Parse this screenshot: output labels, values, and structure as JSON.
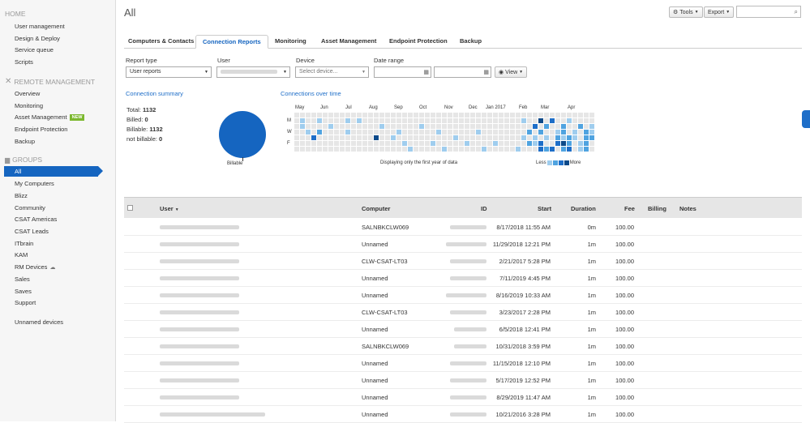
{
  "sidebar": {
    "home_header": "HOME",
    "home_items": [
      "User management",
      "Design & Deploy",
      "Service queue",
      "Scripts"
    ],
    "remote_header": "REMOTE MANAGEMENT",
    "remote_items": [
      "Overview",
      "Monitoring",
      "Asset Management",
      "Endpoint Protection",
      "Backup"
    ],
    "new_badge": "NEW",
    "groups_header": "GROUPS",
    "selected_group": "All",
    "group_items": [
      "My Computers",
      "Blizz",
      "Community",
      "CSAT Americas",
      "CSAT Leads",
      "ITbrain",
      "KAM",
      "RM Devices",
      "Sales",
      "Saves",
      "Support"
    ],
    "unnamed": "Unnamed devices"
  },
  "header": {
    "title": "All",
    "tools": "Tools",
    "export": "Export",
    "search_placeholder": ""
  },
  "tabs": [
    "Computers & Contacts",
    "Connection Reports",
    "Monitoring",
    "Asset Management",
    "Endpoint Protection",
    "Backup"
  ],
  "filters": {
    "report_type_label": "Report type",
    "report_type_value": "User reports",
    "user_label": "User",
    "device_label": "Device",
    "device_placeholder": "Select device...",
    "date_range_label": "Date range",
    "view_button": "View"
  },
  "summary": {
    "title": "Connection summary",
    "total_label": "Total:",
    "total": "1132",
    "billed_label": "Billed:",
    "billed": "0",
    "billable_label": "Billable:",
    "billable": "1132",
    "not_billable_label": "not billable:",
    "not_billable": "0",
    "pie_label": "Billable"
  },
  "heatmap": {
    "title": "Connections over time",
    "months": [
      "May",
      "Jun",
      "Jul",
      "Aug",
      "Sep",
      "Oct",
      "Nov",
      "Dec",
      "Jan 2017",
      "Feb",
      "Mar",
      "Apr"
    ],
    "days": [
      "M",
      "W",
      "F"
    ],
    "note": "Displaying only the first year of data",
    "less": "Less",
    "more": "More",
    "colors": [
      "#e6e6e6",
      "#9fcdee",
      "#4fa3e0",
      "#1e6ec8",
      "#0d4a8a"
    ]
  },
  "table": {
    "headers": {
      "user": "User",
      "computer": "Computer",
      "id": "ID",
      "start": "Start",
      "duration": "Duration",
      "fee": "Fee",
      "billing": "Billing",
      "notes": "Notes"
    },
    "rows": [
      {
        "computer": "SALNBKCLW069",
        "start": "8/17/2018 11:55 AM",
        "duration": "0m",
        "fee": "100.00"
      },
      {
        "computer": "Unnamed",
        "start": "11/29/2018 12:21 PM",
        "duration": "1m",
        "fee": "100.00"
      },
      {
        "computer": "CLW-CSAT-LT03",
        "start": "2/21/2017 5:28 PM",
        "duration": "1m",
        "fee": "100.00"
      },
      {
        "computer": "Unnamed",
        "start": "7/11/2019 4:45 PM",
        "duration": "1m",
        "fee": "100.00"
      },
      {
        "computer": "Unnamed",
        "start": "8/16/2019 10:33 AM",
        "duration": "1m",
        "fee": "100.00"
      },
      {
        "computer": "CLW-CSAT-LT03",
        "start": "3/23/2017 2:28 PM",
        "duration": "1m",
        "fee": "100.00"
      },
      {
        "computer": "Unnamed",
        "start": "6/5/2018 12:41 PM",
        "duration": "1m",
        "fee": "100.00"
      },
      {
        "computer": "SALNBKCLW069",
        "start": "10/31/2018 3:59 PM",
        "duration": "1m",
        "fee": "100.00"
      },
      {
        "computer": "Unnamed",
        "start": "11/15/2018 12:10 PM",
        "duration": "1m",
        "fee": "100.00"
      },
      {
        "computer": "Unnamed",
        "start": "5/17/2019 12:52 PM",
        "duration": "1m",
        "fee": "100.00"
      },
      {
        "computer": "Unnamed",
        "start": "8/29/2019 11:47 AM",
        "duration": "1m",
        "fee": "100.00"
      },
      {
        "computer": "Unnamed",
        "start": "10/21/2016 3:28 PM",
        "duration": "1m",
        "fee": "100.00"
      }
    ]
  }
}
